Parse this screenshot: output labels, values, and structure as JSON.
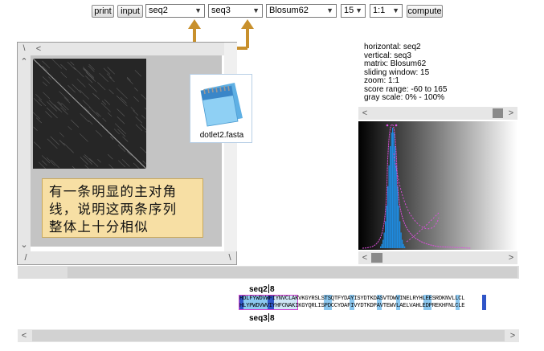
{
  "toolbar": {
    "print_label": "print",
    "input_label": "input",
    "horizontal_select": "seq2",
    "vertical_select": "seq3",
    "matrix_select": "Blosum62",
    "window_select": "15",
    "zoom_select": "1:1",
    "compute_label": "compute"
  },
  "file_icon": {
    "label": "dotlet2.fasta"
  },
  "annotation": {
    "line1": "有一条明显的主对角",
    "line2": "线，说明这两条序列",
    "line3": "整体上十分相似"
  },
  "info": {
    "horizontal": "horizontal: seq2",
    "vertical": "vertical: seq3",
    "matrix": "matrix: Blosum62",
    "window": "sliding window: 15",
    "zoom": "zoom: 1:1",
    "score_range": "score range: -60 to 165",
    "gray_scale": "gray scale: 0% - 100%"
  },
  "alignment": {
    "top_label": "seq2",
    "top_pos": "8",
    "bottom_label": "seq3",
    "bottom_pos": "8",
    "row1": "HDLFYWDVWFIYNVCLAKVKGYRSLSTSQTFYDAYISYDTKDASVTDWVINELRYHLEESRDKNVLLCL",
    "row2": "HLYPWDVWVIYHFCNAKIKGYQRLISPDCCYDAFIVYDTKDPAVTEWVLAELVAHLEDPREKHFNLCLE"
  },
  "colors": {
    "accent_arrow": "#c8902c",
    "annotation_bg": "#f7dfa4",
    "histogram": "#1e8be0",
    "curve": "#d040d0",
    "highlight_dark": "#2f55c8",
    "highlight_light": "#8cc8f0"
  }
}
